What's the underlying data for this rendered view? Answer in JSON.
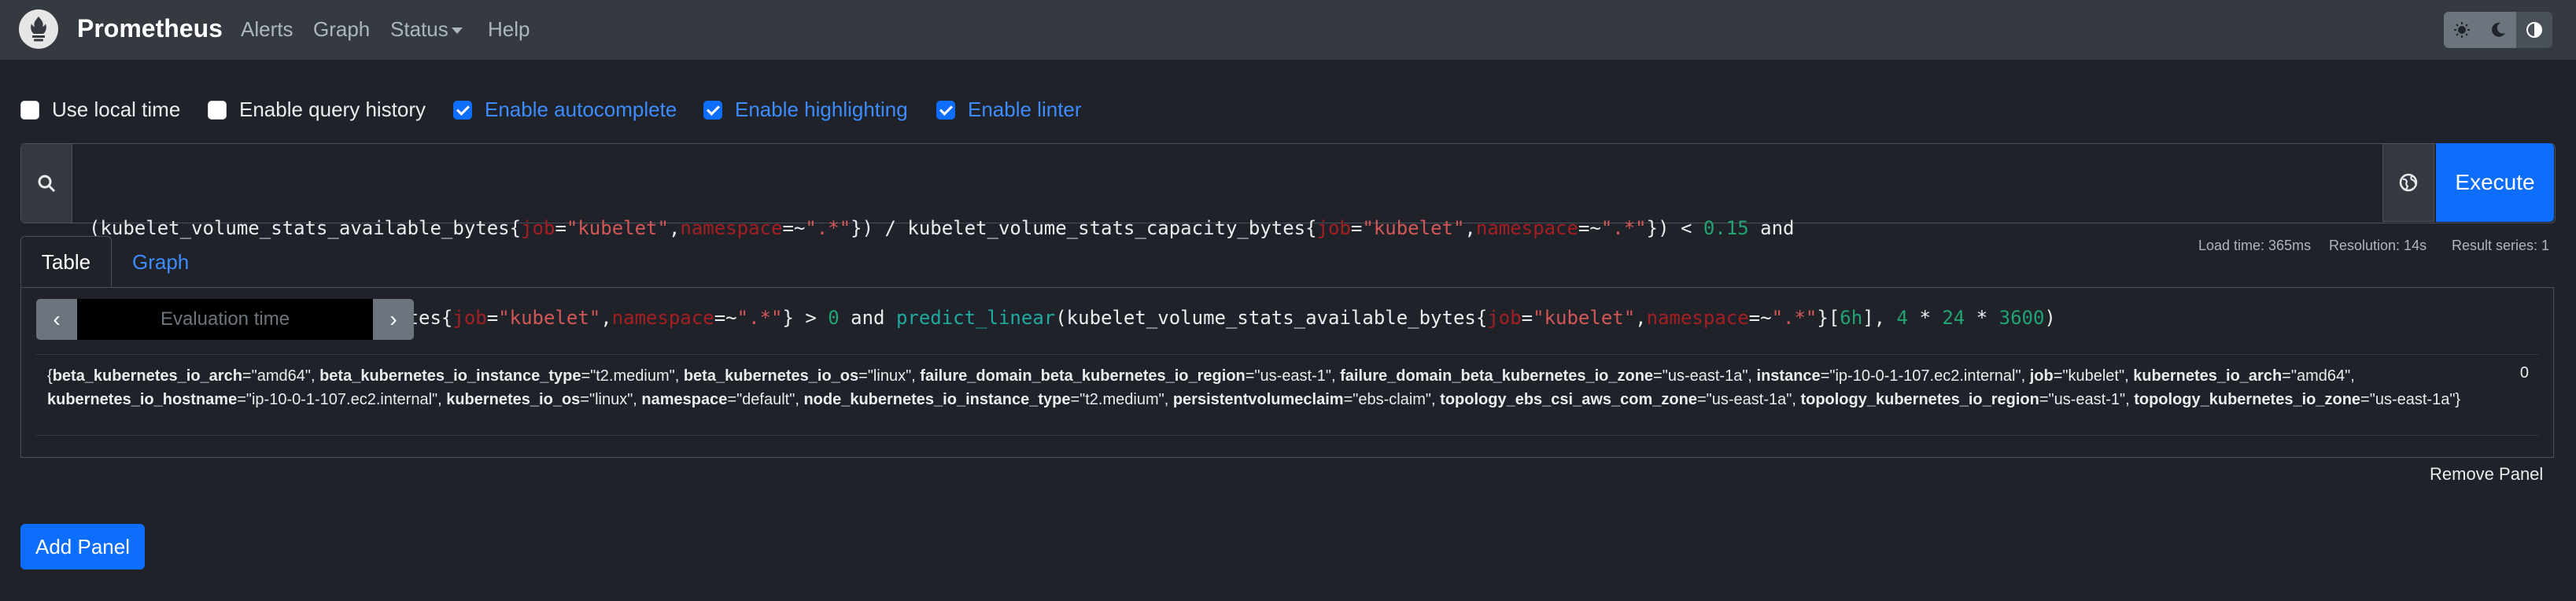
{
  "navbar": {
    "brand": "Prometheus",
    "links": {
      "alerts": "Alerts",
      "graph": "Graph",
      "status": "Status",
      "help": "Help"
    },
    "theme_icons": [
      "sun-icon",
      "moon-icon",
      "contrast-icon"
    ]
  },
  "options": {
    "local_time": {
      "label": "Use local time",
      "checked": false
    },
    "query_history": {
      "label": "Enable query history",
      "checked": false
    },
    "autocomplete": {
      "label": "Enable autocomplete",
      "checked": true
    },
    "highlighting": {
      "label": "Enable highlighting",
      "checked": true
    },
    "linter": {
      "label": "Enable linter",
      "checked": true
    }
  },
  "query": {
    "line1": [
      [
        "(kubelet_volume_stats_available_bytes{",
        "t"
      ],
      [
        "job",
        "l"
      ],
      [
        "=",
        "t"
      ],
      [
        "\"kubelet\"",
        "s"
      ],
      [
        ",",
        "t"
      ],
      [
        "namespace",
        "l"
      ],
      [
        "=~",
        "t"
      ],
      [
        "\".*\"",
        "s"
      ],
      [
        "}) / kubelet_volume_stats_capacity_bytes{",
        "t"
      ],
      [
        "job",
        "l"
      ],
      [
        "=",
        "t"
      ],
      [
        "\"kubelet\"",
        "s"
      ],
      [
        ",",
        "t"
      ],
      [
        "namespace",
        "l"
      ],
      [
        "=~",
        "t"
      ],
      [
        "\".*\"",
        "s"
      ],
      [
        "}) < ",
        "t"
      ],
      [
        "0.15",
        "n"
      ],
      [
        " and",
        "t"
      ]
    ],
    "line2": [
      [
        "kubelet_volume_stats_used_bytes{",
        "t"
      ],
      [
        "job",
        "l"
      ],
      [
        "=",
        "t"
      ],
      [
        "\"kubelet\"",
        "s"
      ],
      [
        ",",
        "t"
      ],
      [
        "namespace",
        "l"
      ],
      [
        "=~",
        "t"
      ],
      [
        "\".*\"",
        "s"
      ],
      [
        "} > ",
        "t"
      ],
      [
        "0",
        "n"
      ],
      [
        " and ",
        "t"
      ],
      [
        "predict_linear",
        "f"
      ],
      [
        "(kubelet_volume_stats_available_bytes{",
        "t"
      ],
      [
        "job",
        "l"
      ],
      [
        "=",
        "t"
      ],
      [
        "\"kubelet\"",
        "s"
      ],
      [
        ",",
        "t"
      ],
      [
        "namespace",
        "l"
      ],
      [
        "=~",
        "t"
      ],
      [
        "\".*\"",
        "s"
      ],
      [
        "}[",
        "t"
      ],
      [
        "6h",
        "n"
      ],
      [
        "], ",
        "t"
      ],
      [
        "4",
        "n"
      ],
      [
        " * ",
        "t"
      ],
      [
        "24",
        "n"
      ],
      [
        " * ",
        "t"
      ],
      [
        "3600",
        "n"
      ],
      [
        ")",
        "t"
      ]
    ],
    "execute_label": "Execute"
  },
  "tabs": {
    "table": "Table",
    "graph": "Graph"
  },
  "stats": {
    "load_time": "Load time: 365ms",
    "resolution": "Resolution: 14s",
    "result_series": "Result series: 1"
  },
  "evaluation": {
    "placeholder": "Evaluation time",
    "prev": "‹",
    "next": "›"
  },
  "result": {
    "labels": [
      [
        "beta_kubernetes_io_arch",
        "amd64"
      ],
      [
        "beta_kubernetes_io_instance_type",
        "t2.medium"
      ],
      [
        "beta_kubernetes_io_os",
        "linux"
      ],
      [
        "failure_domain_beta_kubernetes_io_region",
        "us-east-1"
      ],
      [
        "failure_domain_beta_kubernetes_io_zone",
        "us-east-1a"
      ],
      [
        "instance",
        "ip-10-0-1-107.ec2.internal"
      ],
      [
        "job",
        "kubelet"
      ],
      [
        "kubernetes_io_arch",
        "amd64"
      ],
      [
        "kubernetes_io_hostname",
        "ip-10-0-1-107.ec2.internal"
      ],
      [
        "kubernetes_io_os",
        "linux"
      ],
      [
        "namespace",
        "default"
      ],
      [
        "node_kubernetes_io_instance_type",
        "t2.medium"
      ],
      [
        "persistentvolumeclaim",
        "ebs-claim"
      ],
      [
        "topology_ebs_csi_aws_com_zone",
        "us-east-1a"
      ],
      [
        "topology_kubernetes_io_region",
        "us-east-1"
      ],
      [
        "topology_kubernetes_io_zone",
        "us-east-1a"
      ]
    ],
    "value": "0"
  },
  "actions": {
    "remove_panel": "Remove Panel",
    "add_panel": "Add Panel"
  }
}
